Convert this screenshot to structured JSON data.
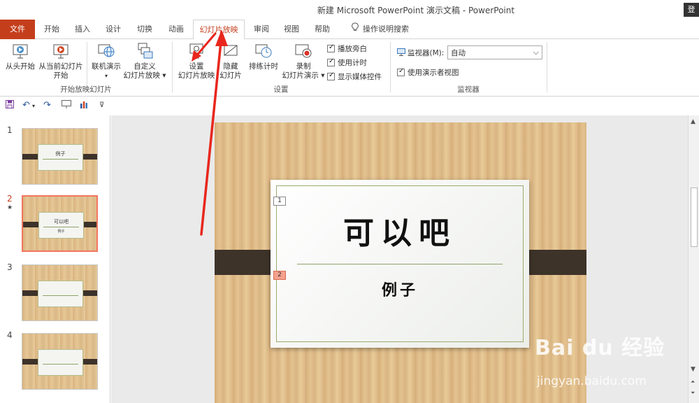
{
  "window": {
    "title": "新建 Microsoft PowerPoint 演示文稿  -  PowerPoint",
    "login": "登"
  },
  "tabs": [
    {
      "label": "文件"
    },
    {
      "label": "开始"
    },
    {
      "label": "插入"
    },
    {
      "label": "设计"
    },
    {
      "label": "切换"
    },
    {
      "label": "动画"
    },
    {
      "label": "幻灯片放映"
    },
    {
      "label": "审阅"
    },
    {
      "label": "视图"
    },
    {
      "label": "帮助"
    },
    {
      "label": "操作说明搜索"
    }
  ],
  "ribbon": {
    "from_beginning": "从头开始",
    "from_current_1": "从当前幻灯片",
    "from_current_2": "开始",
    "online": "联机演示",
    "custom_1": "自定义",
    "custom_2": "幻灯片放映",
    "group_start": "开始放映幻灯片",
    "setup_1": "设置",
    "setup_2": "幻灯片放映",
    "hide_1": "隐藏",
    "hide_2": "幻灯片",
    "rehearse": "排练计时",
    "record_1": "录制",
    "record_2": "幻灯片演示",
    "play_narration": "播放旁白",
    "use_timings": "使用计时",
    "show_media": "显示媒体控件",
    "group_setup": "设置",
    "monitor_label": "监视器(M):",
    "monitor_value": "自动",
    "presenter_view": "使用演示者视图",
    "group_monitor": "监视器"
  },
  "slides": [
    {
      "num": "1",
      "t1": "例子",
      "t2": ""
    },
    {
      "num": "2",
      "t1": "可以吧",
      "t2": "例子"
    },
    {
      "num": "3",
      "t1": "",
      "t2": ""
    },
    {
      "num": "4",
      "t1": "",
      "t2": ""
    }
  ],
  "current_slide": {
    "title": "可以吧",
    "subtitle": "例子",
    "placeholder_1": "1",
    "placeholder_2": "2"
  },
  "watermark": {
    "brand": "Bai du 经验",
    "url": "jingyan.baidu.com"
  },
  "colors": {
    "accent": "#c43e1c",
    "selected_border": "#f2755f",
    "arrow": "#e8261d"
  }
}
